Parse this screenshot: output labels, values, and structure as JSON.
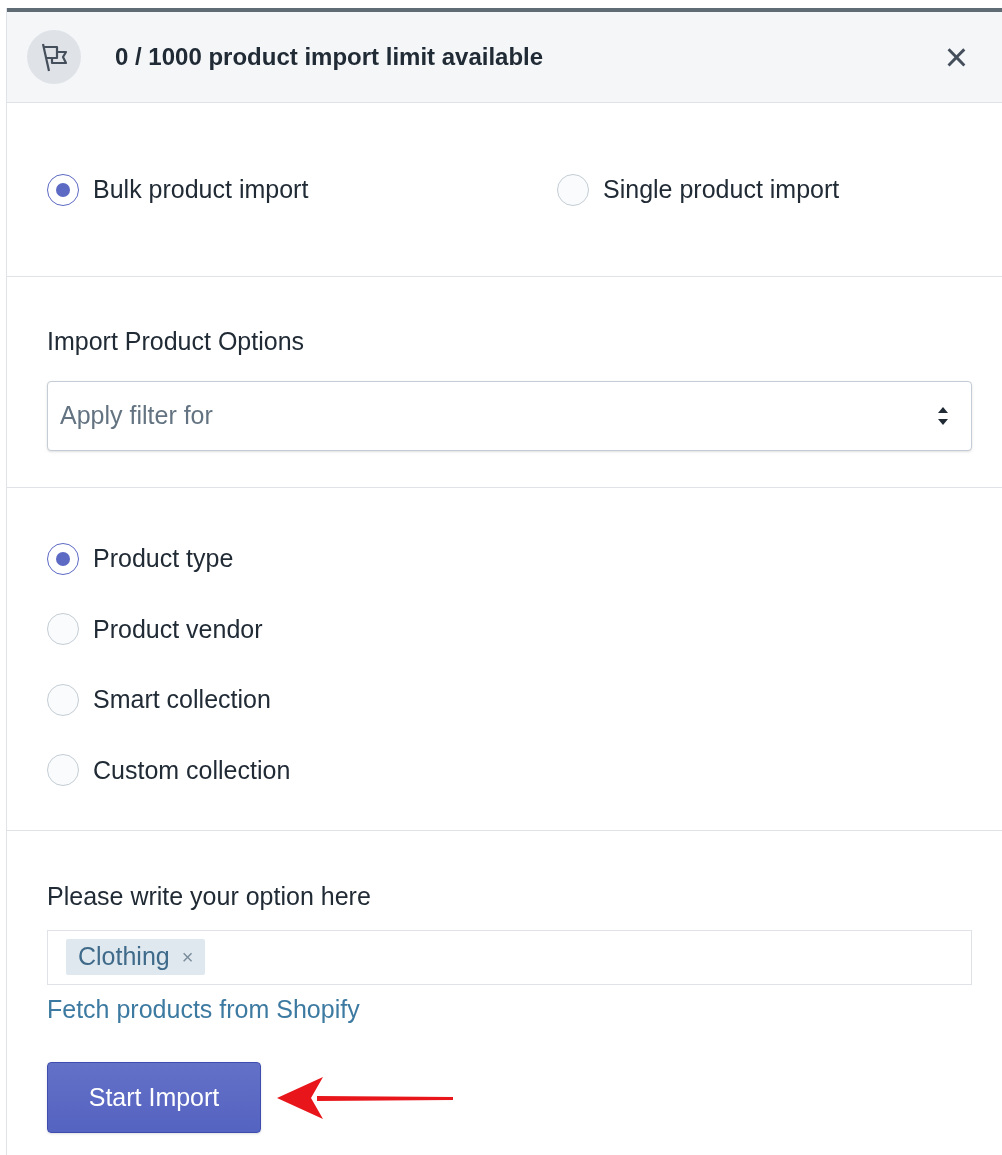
{
  "header": {
    "title": "0 / 1000 product import limit available",
    "close": "×"
  },
  "import_mode": [
    {
      "label": "Bulk product import",
      "selected": true
    },
    {
      "label": "Single product import",
      "selected": false
    }
  ],
  "options": {
    "label": "Import Product Options",
    "select": {
      "placeholder": "Apply filter for"
    }
  },
  "filter_types": [
    {
      "label": "Product type",
      "selected": true
    },
    {
      "label": "Product vendor",
      "selected": false
    },
    {
      "label": "Smart collection",
      "selected": false
    },
    {
      "label": "Custom collection",
      "selected": false
    }
  ],
  "option_field": {
    "label": "Please write your option here",
    "tags": [
      {
        "text": "Clothing",
        "remove": "×"
      }
    ]
  },
  "fetch_link": "Fetch products from Shopify",
  "start_button": "Start Import"
}
